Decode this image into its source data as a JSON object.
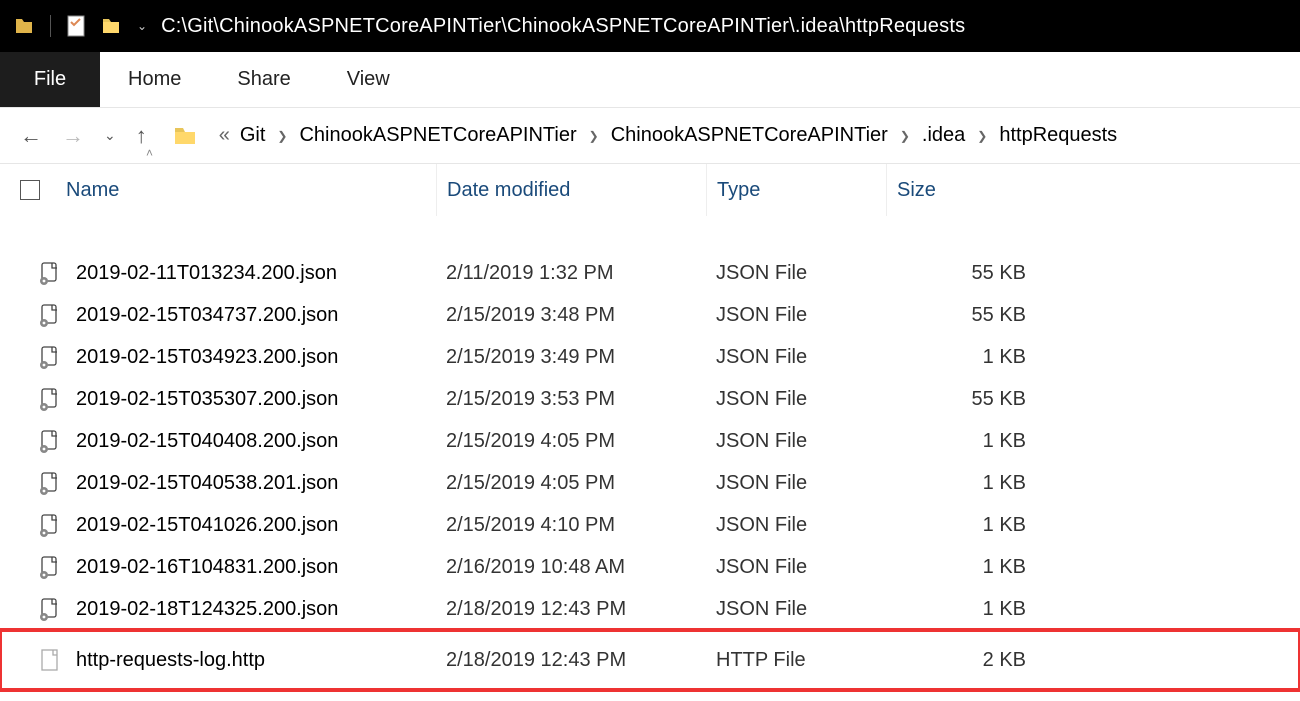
{
  "titlebar": {
    "address": "C:\\Git\\ChinookASPNETCoreAPINTier\\ChinookASPNETCoreAPINTier\\.idea\\httpRequests"
  },
  "ribbon": {
    "tabs": [
      "File",
      "Home",
      "Share",
      "View"
    ]
  },
  "breadcrumbs": {
    "lead": "«",
    "items": [
      "Git",
      "ChinookASPNETCoreAPINTier",
      "ChinookASPNETCoreAPINTier",
      ".idea",
      "httpRequests"
    ]
  },
  "columns": {
    "name": "Name",
    "date": "Date modified",
    "type": "Type",
    "size": "Size"
  },
  "files": [
    {
      "name": "2019-02-11T013234.200.json",
      "date": "2/11/2019 1:32 PM",
      "type": "JSON File",
      "size": "55 KB",
      "icon": "json"
    },
    {
      "name": "2019-02-15T034737.200.json",
      "date": "2/15/2019 3:48 PM",
      "type": "JSON File",
      "size": "55 KB",
      "icon": "json"
    },
    {
      "name": "2019-02-15T034923.200.json",
      "date": "2/15/2019 3:49 PM",
      "type": "JSON File",
      "size": "1 KB",
      "icon": "json"
    },
    {
      "name": "2019-02-15T035307.200.json",
      "date": "2/15/2019 3:53 PM",
      "type": "JSON File",
      "size": "55 KB",
      "icon": "json"
    },
    {
      "name": "2019-02-15T040408.200.json",
      "date": "2/15/2019 4:05 PM",
      "type": "JSON File",
      "size": "1 KB",
      "icon": "json"
    },
    {
      "name": "2019-02-15T040538.201.json",
      "date": "2/15/2019 4:05 PM",
      "type": "JSON File",
      "size": "1 KB",
      "icon": "json"
    },
    {
      "name": "2019-02-15T041026.200.json",
      "date": "2/15/2019 4:10 PM",
      "type": "JSON File",
      "size": "1 KB",
      "icon": "json"
    },
    {
      "name": "2019-02-16T104831.200.json",
      "date": "2/16/2019 10:48 AM",
      "type": "JSON File",
      "size": "1 KB",
      "icon": "json"
    },
    {
      "name": "2019-02-18T124325.200.json",
      "date": "2/18/2019 12:43 PM",
      "type": "JSON File",
      "size": "1 KB",
      "icon": "json"
    },
    {
      "name": "http-requests-log.http",
      "date": "2/18/2019 12:43 PM",
      "type": "HTTP File",
      "size": "2 KB",
      "icon": "plain",
      "highlight": true
    }
  ]
}
